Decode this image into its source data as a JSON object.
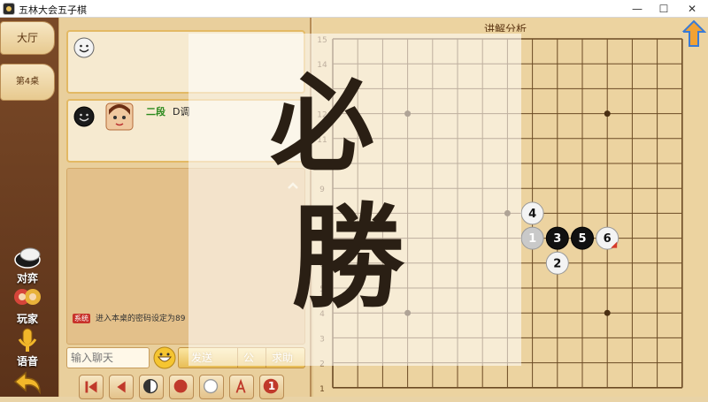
{
  "window": {
    "title": "五林大会五子棋",
    "minimize": "—",
    "maximize": "☐",
    "close": "✕"
  },
  "tabs": {
    "lobby": "大厅",
    "table": "第4桌"
  },
  "side_buttons": [
    {
      "label": "对弈",
      "icon": "game-stone-icon"
    },
    {
      "label": "玩家",
      "icon": "players-icon"
    },
    {
      "label": "语音",
      "icon": "microphone-icon"
    },
    {
      "label": "",
      "icon": "back-arrow-icon"
    }
  ],
  "player2": {
    "name": "二段",
    "suffix": "D调"
  },
  "chat": {
    "system_tag": "系统",
    "system_message": "进入本桌的密码设定为89",
    "input_placeholder": "输入聊天",
    "send_label": "发送",
    "public_label": "公",
    "help_label": "求助"
  },
  "board": {
    "title": "讲解分析",
    "row_labels": [
      "15",
      "14",
      "13",
      "12",
      "11",
      "10",
      "9",
      "8",
      "7",
      "6",
      "5",
      "4",
      "3",
      "2",
      "1"
    ],
    "stones": [
      {
        "n": "1",
        "color": "gray",
        "col": 8,
        "row": 8
      },
      {
        "n": "2",
        "color": "white",
        "col": 9,
        "row": 9
      },
      {
        "n": "3",
        "color": "black",
        "col": 9,
        "row": 8
      },
      {
        "n": "4",
        "color": "white",
        "col": 8,
        "row": 7
      },
      {
        "n": "5",
        "color": "black",
        "col": 10,
        "row": 8
      },
      {
        "n": "6",
        "color": "white",
        "col": 11,
        "row": 8
      }
    ]
  },
  "overlay_text": {
    "line1": "必",
    "line2": "勝"
  },
  "toolbar": {
    "move_number": "1"
  }
}
